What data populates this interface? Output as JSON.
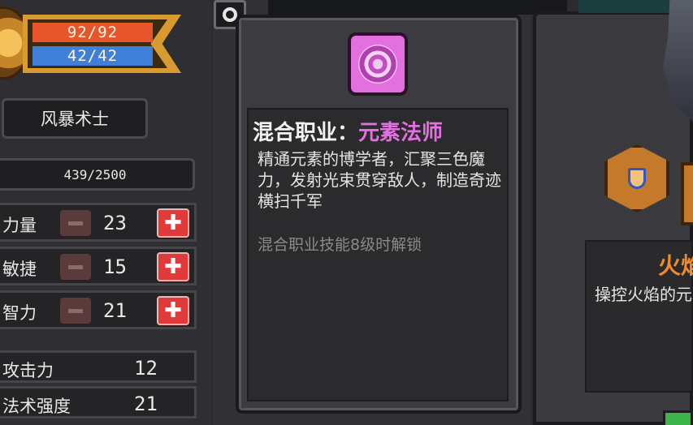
{
  "player": {
    "hp": "92/92",
    "mp": "42/42",
    "class_name": "风暴术士",
    "exp": "439/2500"
  },
  "stats": [
    {
      "label": "力量",
      "value": "23"
    },
    {
      "label": "敏捷",
      "value": "15"
    },
    {
      "label": "智力",
      "value": "21"
    }
  ],
  "derived": [
    {
      "label": "攻击力",
      "value": "12"
    },
    {
      "label": "法术强度",
      "value": "21"
    }
  ],
  "tooltip": {
    "title_prefix": "混合职业：",
    "title_role": "元素法师",
    "description": "精通元素的博学者，汇聚三色魔力，发射光束贯穿敌人，制造奇迹横扫千军",
    "unlock_note": "混合职业技能8级时解锁",
    "icon": "vortex-icon"
  },
  "right_card": {
    "title": "火焰",
    "description": "操控火焰的元素魔法"
  },
  "colors": {
    "hp": "#e7562a",
    "mp": "#3f7fd8",
    "role_accent": "#e36fe0",
    "plus_button": "#e13a3a",
    "fire_title": "#f08a2a"
  }
}
